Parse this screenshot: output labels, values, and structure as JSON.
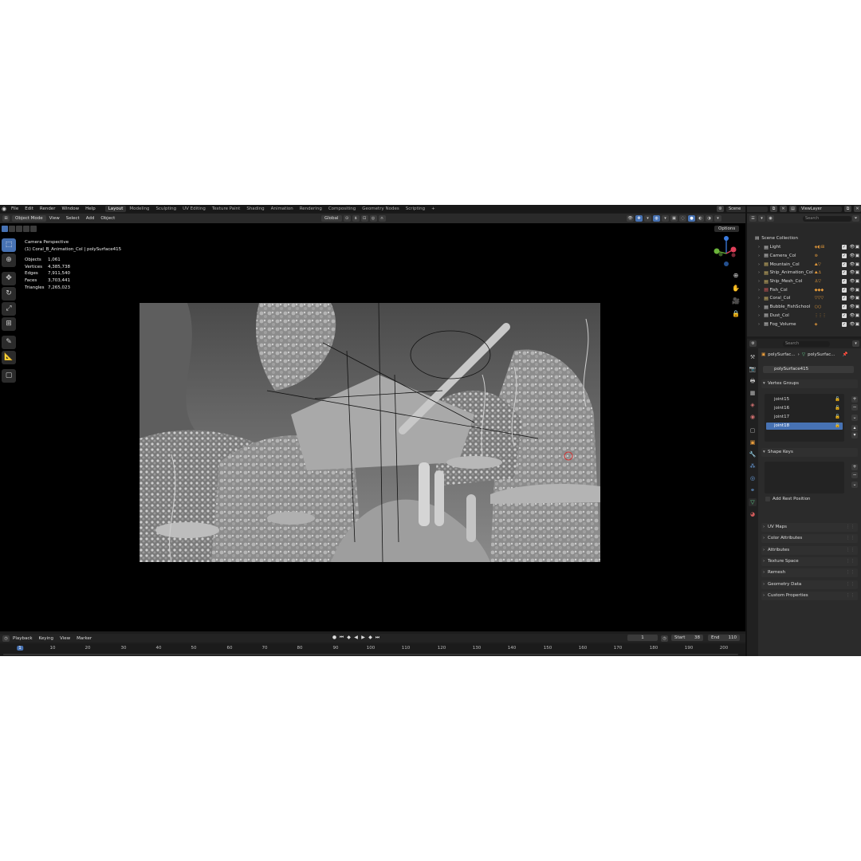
{
  "menu": {
    "items": [
      "File",
      "Edit",
      "Render",
      "Window",
      "Help"
    ],
    "workspaces": [
      "Layout",
      "Modeling",
      "Sculpting",
      "UV Editing",
      "Texture Paint",
      "Shading",
      "Animation",
      "Rendering",
      "Compositing",
      "Geometry Nodes",
      "Scripting"
    ],
    "add_tab": "+",
    "scene": "Scene",
    "view_layer": "ViewLayer"
  },
  "viewport_header": {
    "mode": "Object Mode",
    "menus": [
      "View",
      "Select",
      "Add",
      "Object"
    ],
    "transform_orientation": "Global",
    "options": "Options"
  },
  "viewport": {
    "camera_label": "Camera Perspective",
    "context_label": "(1) Coral_B_Animation_Col | polySurface415",
    "stats": [
      {
        "label": "Objects",
        "value": "1,061"
      },
      {
        "label": "Vertices",
        "value": "4,385,738"
      },
      {
        "label": "Edges",
        "value": "7,911,540"
      },
      {
        "label": "Faces",
        "value": "3,703,441"
      },
      {
        "label": "Triangles",
        "value": "7,265,023"
      }
    ]
  },
  "timeline": {
    "menus": [
      "Playback",
      "Keying",
      "View",
      "Marker"
    ],
    "current_frame": "1",
    "start_label": "Start",
    "start": "38",
    "end_label": "End",
    "end": "110",
    "ticks": [
      "1",
      "10",
      "20",
      "30",
      "40",
      "50",
      "60",
      "70",
      "80",
      "90",
      "100",
      "110",
      "120",
      "130",
      "140",
      "150",
      "160",
      "170",
      "180",
      "190",
      "200"
    ]
  },
  "outliner": {
    "search_placeholder": "Search",
    "scene_collection": "Scene Collection",
    "collections": [
      {
        "name": "Light",
        "color": "#dcdcdc"
      },
      {
        "name": "Camera_Col",
        "color": "#dcdcdc"
      },
      {
        "name": "Mountain_Col",
        "color": "#e0c46c"
      },
      {
        "name": "Ship_Animation_Col",
        "color": "#e0c46c"
      },
      {
        "name": "Ship_Mesh_Col",
        "color": "#e0c46c"
      },
      {
        "name": "Fish_Col",
        "color": "#e05a5a"
      },
      {
        "name": "Coral_Col",
        "color": "#e0c46c"
      },
      {
        "name": "Bubble_FishSchool",
        "color": "#dcdcdc"
      },
      {
        "name": "Dust_Col",
        "color": "#dcdcdc"
      },
      {
        "name": "Fog_Volume",
        "color": "#dcdcdc"
      }
    ]
  },
  "properties": {
    "search_placeholder": "Search",
    "breadcrumb_object": "polySurfac...",
    "breadcrumb_mesh": "polySurfac...",
    "mesh_name": "polySurface415",
    "vertex_groups_title": "Vertex Groups",
    "vertex_groups": [
      "joint15",
      "joint16",
      "joint17",
      "joint18"
    ],
    "selected_group": "joint18",
    "shape_keys_title": "Shape Keys",
    "add_rest_position": "Add Rest Position",
    "collapsed_panels": [
      "UV Maps",
      "Color Attributes",
      "Attributes",
      "Texture Space",
      "Remesh",
      "Geometry Data",
      "Custom Properties"
    ]
  },
  "colors": {
    "accent": "#4772b3",
    "background": "#1d1d1d",
    "viewport": "#000000",
    "header": "#2a2a2a"
  }
}
